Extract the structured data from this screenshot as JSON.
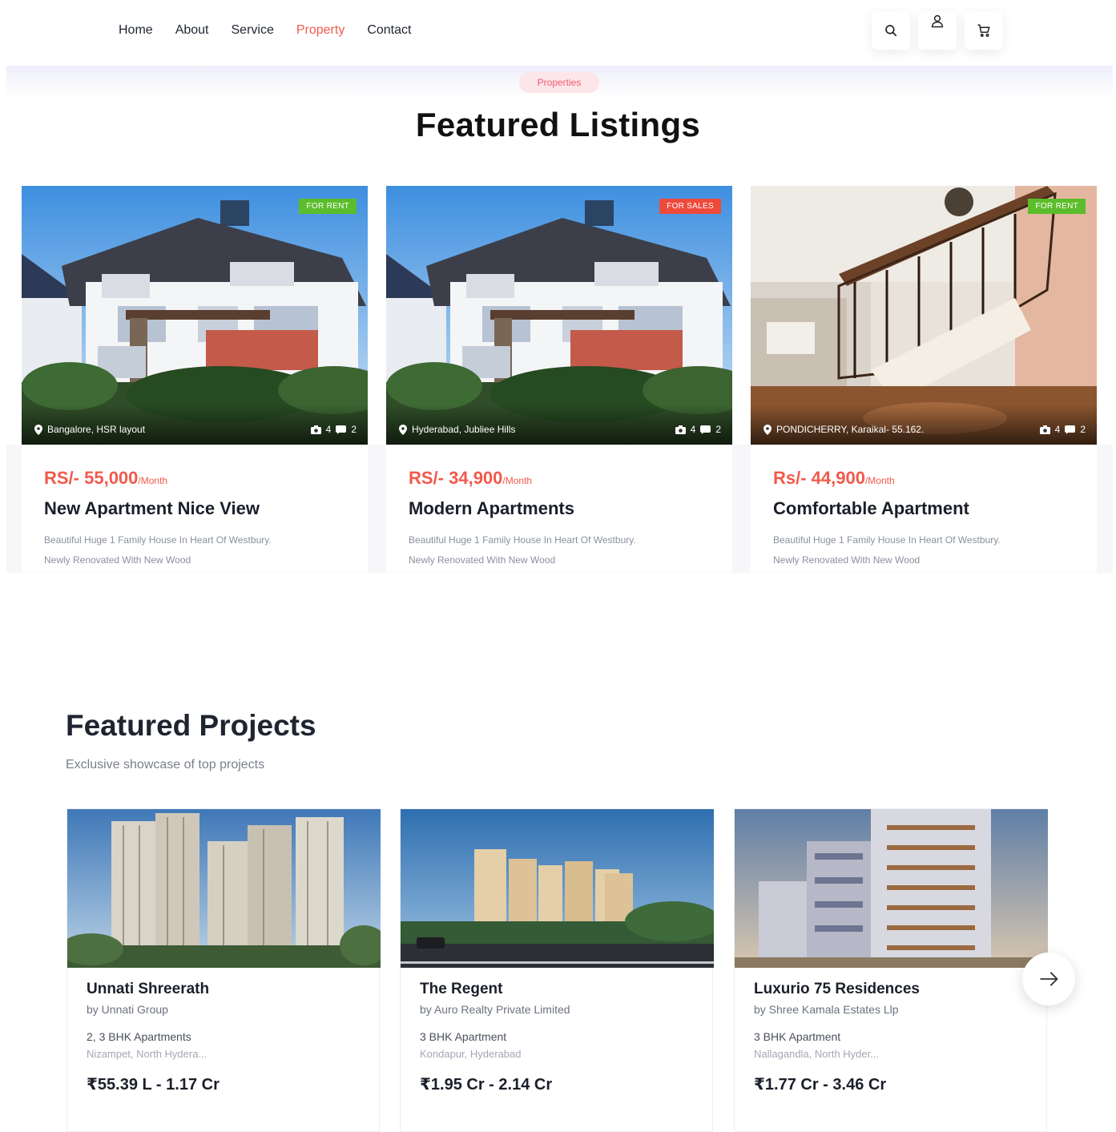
{
  "nav": {
    "links": [
      {
        "label": "Home",
        "active": false
      },
      {
        "label": "About",
        "active": false
      },
      {
        "label": "Service",
        "active": false
      },
      {
        "label": "Property",
        "active": true
      },
      {
        "label": "Contact",
        "active": false
      }
    ],
    "icons": [
      "search-icon",
      "user-icon",
      "cart-icon"
    ]
  },
  "featured": {
    "badge": "Properties",
    "title": "Featured Listings",
    "listings": [
      {
        "tag": "FOR RENT",
        "tag_color": "#5bbd2b",
        "location": "Bangalore, HSR layout",
        "photos": "4",
        "rooms": "2",
        "price": "RS/- 55,000",
        "per": "/Month",
        "title": "New Apartment Nice View",
        "desc_line1": "Beautiful Huge 1 Family House In Heart Of Westbury.",
        "desc_line2": "Newly Renovated With New Wood"
      },
      {
        "tag": "FOR SALES",
        "tag_color": "#ee4a3c",
        "location": "Hyderabad, Jubliee Hills",
        "photos": "4",
        "rooms": "2",
        "price": "RS/- 34,900",
        "per": "/Month",
        "title": "Modern Apartments",
        "desc_line1": "Beautiful Huge 1 Family House In Heart Of Westbury.",
        "desc_line2": "Newly Renovated With New Wood"
      },
      {
        "tag": "FOR RENT",
        "tag_color": "#5bbd2b",
        "location": "PONDICHERRY, Karaikal- 55.162.",
        "photos": "4",
        "rooms": "2",
        "price": "Rs/- 44,900",
        "per": "/Month",
        "title": "Comfortable Apartment",
        "desc_line1": "Beautiful Huge 1 Family House In Heart Of Westbury.",
        "desc_line2": "Newly Renovated With New Wood"
      }
    ]
  },
  "projects": {
    "heading_light": "Featured",
    "heading_bold": "Projects",
    "subtitle": "Exclusive showcase of top projects",
    "items": [
      {
        "name": "Unnati Shreerath",
        "by": "by Unnati Group",
        "type": "2, 3 BHK Apartments",
        "location": "Nizampet, North Hydera...",
        "price": "₹55.39 L - 1.17 Cr"
      },
      {
        "name": "The Regent",
        "by": "by Auro Realty Private Limited",
        "type": "3 BHK Apartment",
        "location": "Kondapur, Hyderabad",
        "price": "₹1.95 Cr - 2.14 Cr"
      },
      {
        "name": "Luxurio 75 Residences",
        "by": "by Shree Kamala Estates Llp",
        "type": "3 BHK Apartment",
        "location": "Nallagandla, North Hyder...",
        "price": "₹1.77 Cr - 3.46 Cr"
      }
    ],
    "next_icon": "arrow-right-icon"
  },
  "colors": {
    "accent": "#f05a4b",
    "badge_bg": "#fde6ea",
    "rent": "#5bbd2b",
    "sale": "#ee4a3c"
  }
}
